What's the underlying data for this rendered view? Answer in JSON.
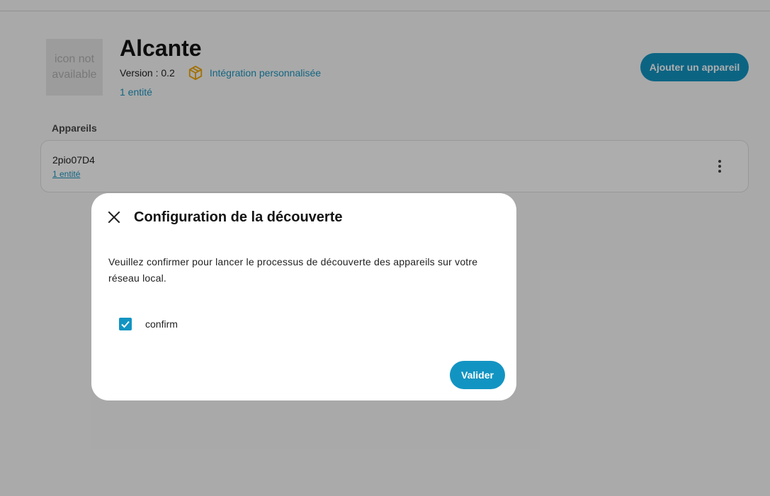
{
  "integration": {
    "icon_placeholder": "icon not available",
    "title": "Alcante",
    "version": "Version : 0.2",
    "custom_label": "Intégration personnalisée",
    "entities_link": "1 entité"
  },
  "actions": {
    "add_device": "Ajouter un appareil"
  },
  "devices": {
    "section_label": "Appareils",
    "items": [
      {
        "name": "2pio07D4",
        "entities": "1 entité"
      }
    ]
  },
  "dialog": {
    "title": "Configuration de la découverte",
    "description": "Veuillez confirmer pour lancer le processus de découverte des appareils sur votre réseau local.",
    "checkbox_label": "confirm",
    "checkbox_checked": true,
    "submit_label": "Valider"
  },
  "colors": {
    "accent": "#1294c2",
    "badge": "#f0a500",
    "scrim": "rgba(0,0,0,0.32)"
  },
  "icons": {
    "close": "close-icon",
    "badge": "package-icon",
    "overflow": "dots-vertical-icon",
    "check": "check-icon"
  }
}
